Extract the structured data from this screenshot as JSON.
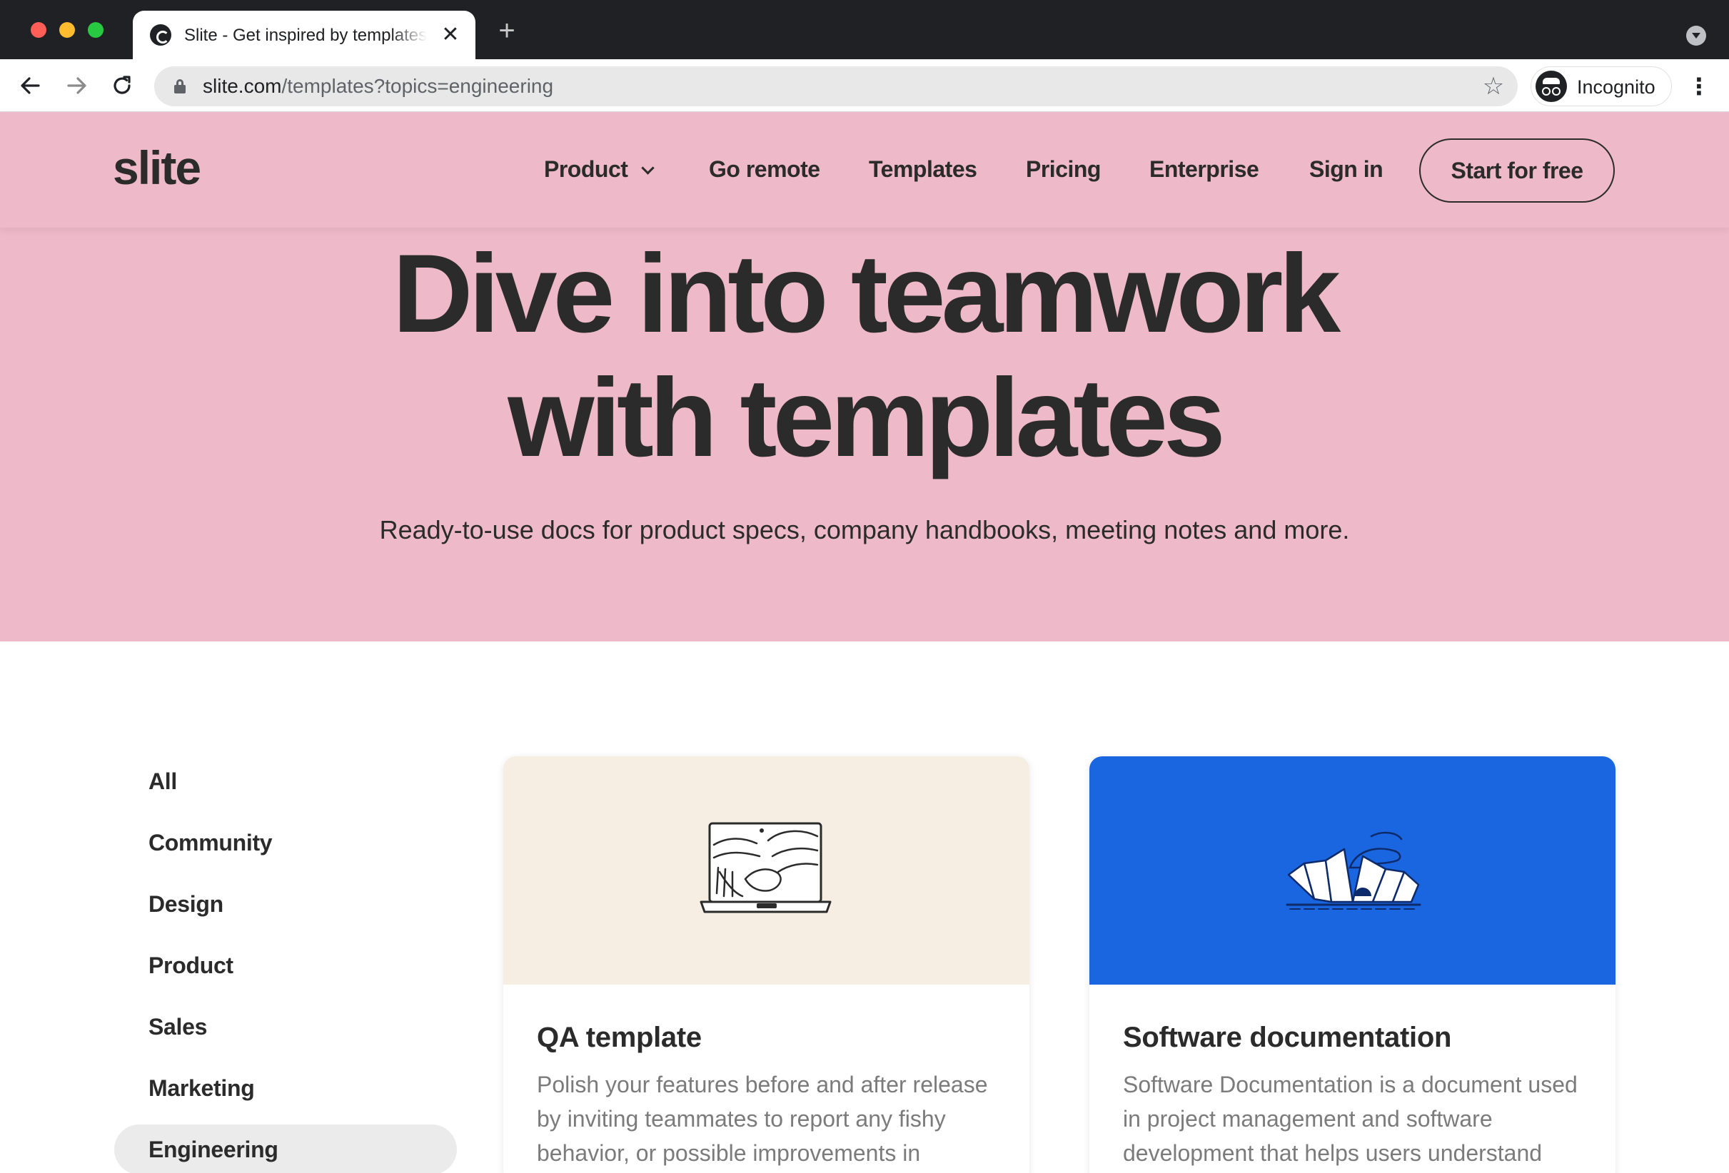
{
  "browser": {
    "tab_title": "Slite - Get inspired by templates",
    "tab_close": "✕",
    "new_tab": "+",
    "url_host": "slite.com",
    "url_path": "/templates?topics=engineering",
    "star_glyph": "☆",
    "incognito_label": "Incognito",
    "icons": [
      "back-arrow-icon",
      "forward-arrow-icon",
      "reload-icon",
      "lock-icon",
      "star-icon",
      "incognito-icon",
      "kebab-menu-icon"
    ]
  },
  "header": {
    "logo": "slite",
    "nav": {
      "product": "Product",
      "go_remote": "Go remote",
      "templates": "Templates",
      "pricing": "Pricing",
      "enterprise": "Enterprise",
      "sign_in": "Sign in"
    },
    "cta": "Start for free"
  },
  "hero": {
    "title_line1": "Dive into teamwork",
    "title_line2": "with templates",
    "subtitle": "Ready-to-use docs for product specs, company handbooks, meeting notes and more."
  },
  "sidebar": {
    "active": "Engineering",
    "items": [
      "All",
      "Community",
      "Design",
      "Product",
      "Sales",
      "Marketing",
      "Engineering"
    ]
  },
  "cards": [
    {
      "title": "QA template",
      "description": "Polish your features before and after release by inviting teammates to report any fishy behavior, or possible improvements in",
      "art_bg": "#f6ede3"
    },
    {
      "title": "Software documentation",
      "description": "Software Documentation is a document used in project management and software development that helps users understand",
      "art_bg": "#1a66e0"
    }
  ],
  "colors": {
    "brand_pink": "#eeb9c9",
    "text_dark": "#2b2b2b",
    "card_blue": "#1a66e0",
    "chrome_dark": "#202124"
  }
}
